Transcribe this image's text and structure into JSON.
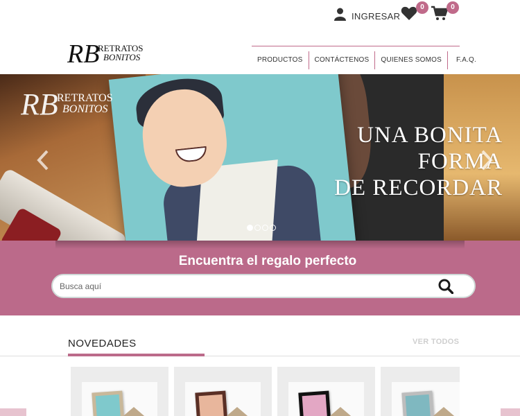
{
  "header": {
    "login_label": "INGRESAR",
    "wishlist_count": "0",
    "cart_count": "0",
    "logo_text_line1": "RETRATOS",
    "logo_text_line2": "BONITOS"
  },
  "nav": {
    "items": [
      {
        "label": "PRODUCTOS"
      },
      {
        "label": "CONTÁCTENOS"
      },
      {
        "label": "QUIENES SOMOS"
      },
      {
        "label": "F.A.Q."
      }
    ]
  },
  "hero": {
    "logo_text_line1": "RETRATOS",
    "logo_text_line2": "BONITOS",
    "title_line1": "UNA BONITA FORMA",
    "title_line2": "DE RECORDAR",
    "slide_count": 4,
    "active_slide": 1
  },
  "search": {
    "title": "Encuentra el regalo perfecto",
    "placeholder": "Busca aquí",
    "value": ""
  },
  "novedades": {
    "title": "NOVEDADES",
    "view_all": "VER TODOS"
  },
  "colors": {
    "accent": "#bb6a8a",
    "badge": "#c06a8a"
  },
  "icons": {
    "login": "user-icon",
    "wishlist": "heart-icon",
    "cart": "cart-icon",
    "search": "search-icon",
    "prev": "chevron-left-icon",
    "next": "chevron-right-icon"
  }
}
